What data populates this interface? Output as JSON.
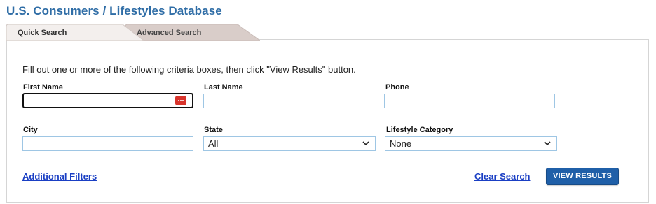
{
  "header": {
    "title": "U.S. Consumers / Lifestyles Database"
  },
  "tabs": [
    {
      "label": "Quick Search",
      "active": true
    },
    {
      "label": "Advanced Search",
      "active": false
    }
  ],
  "form": {
    "instructions": "Fill out one or more of the following criteria boxes, then click \"View Results\" button.",
    "first_name": {
      "label": "First Name",
      "value": ""
    },
    "last_name": {
      "label": "Last Name",
      "value": ""
    },
    "phone": {
      "label": "Phone",
      "value": ""
    },
    "city": {
      "label": "City",
      "value": ""
    },
    "state": {
      "label": "State",
      "selected": "All"
    },
    "lifestyle": {
      "label": "Lifestyle Category",
      "selected": "None"
    }
  },
  "actions": {
    "additional_filters": "Additional Filters",
    "clear_search": "Clear Search",
    "view_results": "VIEW RESULTS"
  },
  "colors": {
    "title": "#2f6da6",
    "field_border": "#9ec6e4",
    "button": "#1f5fa8",
    "link": "#1a3fc4",
    "password_manager_icon": "#d8342c"
  },
  "icons": [
    "password-manager-icon",
    "chevron-down-icon"
  ]
}
